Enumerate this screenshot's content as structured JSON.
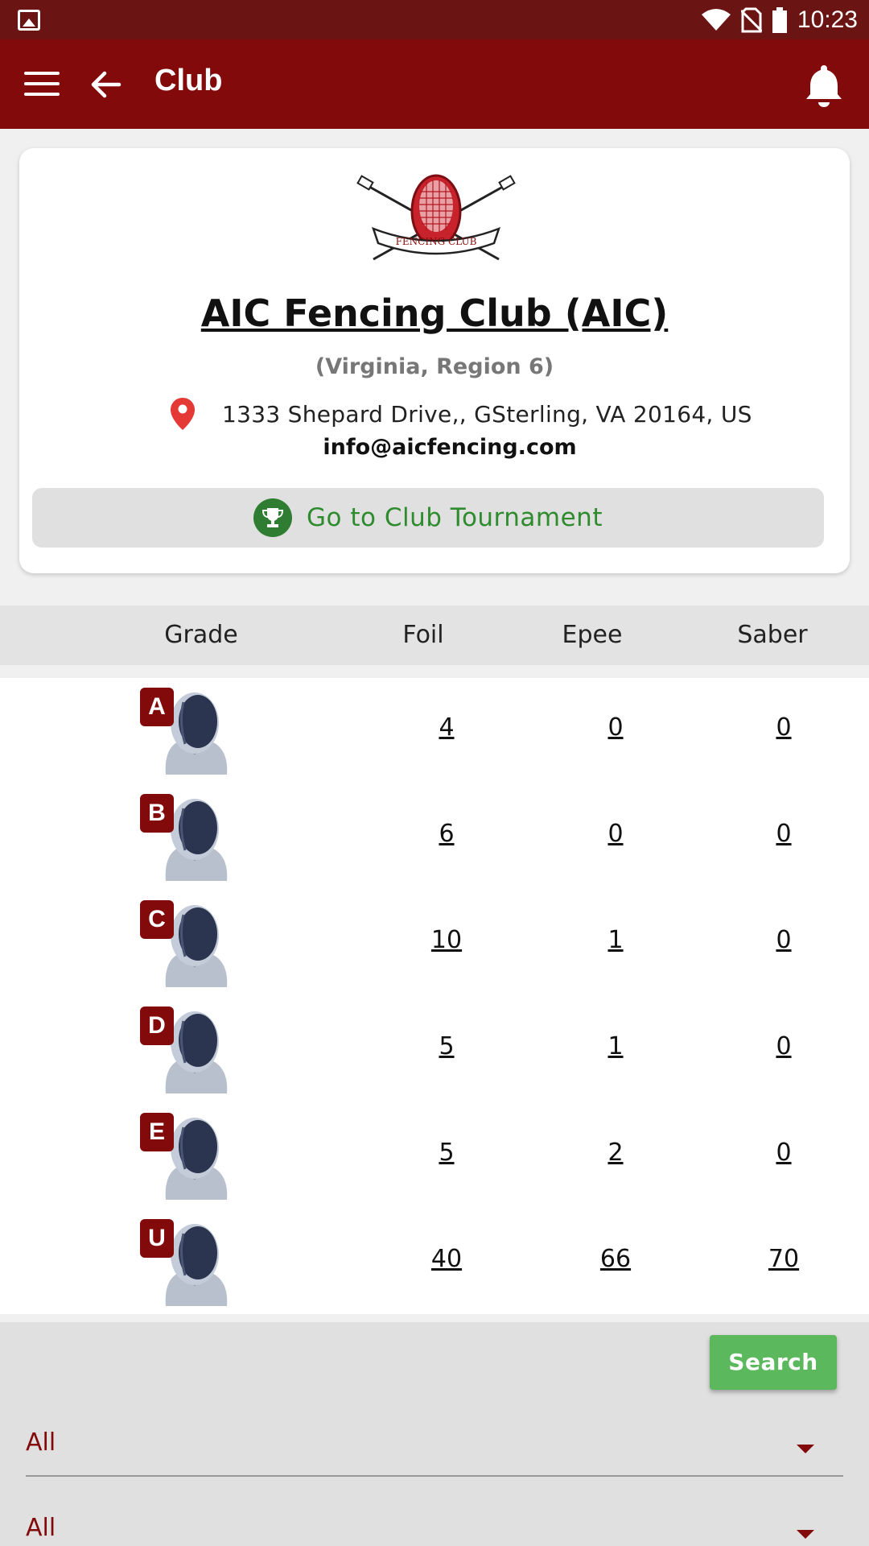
{
  "status_bar": {
    "time": "10:23"
  },
  "app_bar": {
    "title": "Club"
  },
  "club": {
    "name": "AIC Fencing Club (AIC)",
    "region": "(Virginia, Region 6)",
    "address": "1333 Shepard Drive,, GSterling, VA 20164, US",
    "email": "info@aicfencing.com",
    "logo_text": "FENCING CLUB",
    "tournament_button_label": "Go to Club Tournament"
  },
  "table": {
    "headers": {
      "grade": "Grade",
      "foil": "Foil",
      "epee": "Epee",
      "saber": "Saber"
    },
    "rows": [
      {
        "grade": "A",
        "foil": "4",
        "epee": "0",
        "saber": "0"
      },
      {
        "grade": "B",
        "foil": "6",
        "epee": "0",
        "saber": "0"
      },
      {
        "grade": "C",
        "foil": "10",
        "epee": "1",
        "saber": "0"
      },
      {
        "grade": "D",
        "foil": "5",
        "epee": "1",
        "saber": "0"
      },
      {
        "grade": "E",
        "foil": "5",
        "epee": "2",
        "saber": "0"
      },
      {
        "grade": "U",
        "foil": "40",
        "epee": "66",
        "saber": "70"
      }
    ]
  },
  "filters": {
    "search_label": "Search",
    "select_1_value": "All",
    "select_2_value": "All"
  },
  "colors": {
    "brand": "#820a0a",
    "status_bar": "#6a1414",
    "accent_green": "#5cb85c",
    "trophy_green": "#2e7d32"
  },
  "icons": [
    "image-icon",
    "wifi-icon",
    "no-sim-icon",
    "battery-icon",
    "menu-icon",
    "back-arrow-icon",
    "bell-icon",
    "location-pin-icon",
    "trophy-icon",
    "fencer-mask-icon",
    "dropdown-caret-icon"
  ]
}
